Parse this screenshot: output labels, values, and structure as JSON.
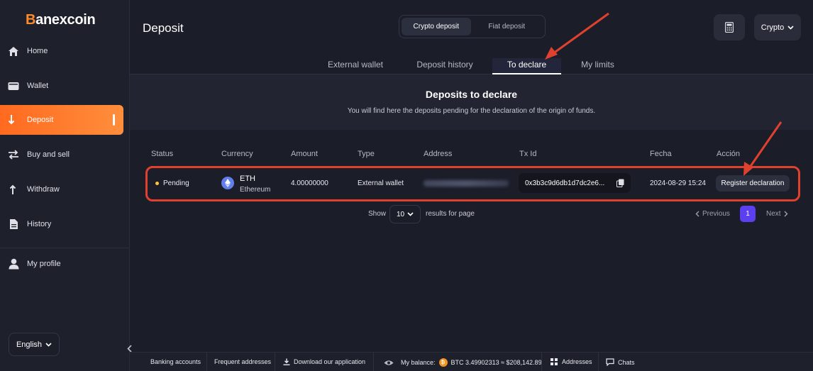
{
  "brand": {
    "logo_b": "B",
    "logo_rest": "anexcoin"
  },
  "sidebar": {
    "items": [
      {
        "label": "Home",
        "icon": "home-icon"
      },
      {
        "label": "Wallet",
        "icon": "wallet-icon"
      },
      {
        "label": "Deposit",
        "icon": "arrow-down-icon",
        "active": true
      },
      {
        "label": "Buy and sell",
        "icon": "swap-icon"
      },
      {
        "label": "Withdraw",
        "icon": "arrow-up-icon"
      },
      {
        "label": "History",
        "icon": "document-icon"
      },
      {
        "label": "My profile",
        "icon": "user-icon"
      }
    ],
    "language": "English"
  },
  "header": {
    "title": "Deposit",
    "segment": {
      "active": "Crypto deposit",
      "inactive": "Fiat deposit"
    },
    "currency_button": "Crypto"
  },
  "tabs": [
    "External wallet",
    "Deposit history",
    "To declare",
    "My limits"
  ],
  "active_tab": "To declare",
  "declare": {
    "title": "Deposits to declare",
    "subtitle": "You will find here the deposits pending for the declaration of the origin of funds."
  },
  "table": {
    "headers": [
      "Status",
      "Currency",
      "Amount",
      "Type",
      "Address",
      "Tx Id",
      "Fecha",
      "Acción"
    ],
    "rows": [
      {
        "status": "Pending",
        "currency_code": "ETH",
        "currency_name": "Ethereum",
        "amount": "4.00000000",
        "type": "External wallet",
        "tx_id": "0x3b3c9d6db1d7dc2e6...",
        "date": "2024-08-29 15:24",
        "action": "Register declaration"
      }
    ]
  },
  "pagination": {
    "show_label": "Show",
    "page_size": "10",
    "per_page_label": "results for page",
    "prev": "Previous",
    "current": "1",
    "next": "Next"
  },
  "footer": {
    "banking": "Banking accounts",
    "frequent": "Frequent addresses",
    "download": "Download our application",
    "balance_label": "My balance:",
    "balance_value": "BTC 3.49902313 ≈ $208,142.89",
    "addresses": "Addresses",
    "chats": "Chats"
  },
  "colors": {
    "accent": "#ff7a2b",
    "highlight": "#e0412f",
    "page_active": "#5b3ff0",
    "pending": "#ffc33b"
  }
}
